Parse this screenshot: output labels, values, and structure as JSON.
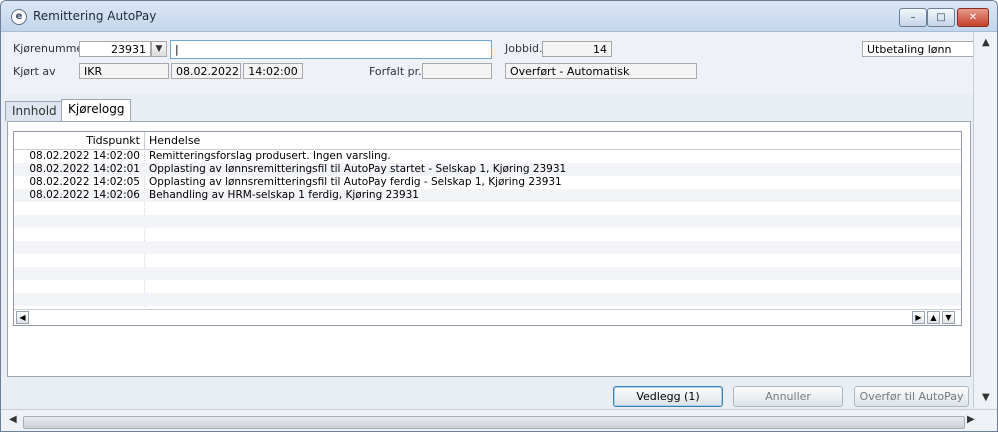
{
  "window": {
    "title": "Remittering AutoPay",
    "app_icon": "e",
    "minimize": "–",
    "restore": "□",
    "close": "✕"
  },
  "form": {
    "run_number_label": "Kjørenummer",
    "run_number_value": "23931",
    "description_value": "|",
    "job_label": "Jobbid.",
    "job_value": "14",
    "type_value": "Utbetaling lønn",
    "run_by_label": "Kjørt av",
    "run_by_value": "IKR",
    "run_date": "08.02.2022",
    "run_time": "14:02:00",
    "due_label": "Forfalt pr.",
    "due_value": "",
    "status_value": "Overført - Automatisk"
  },
  "tabs": [
    {
      "label": "Innhold"
    },
    {
      "label": "Kjørelogg"
    }
  ],
  "log": {
    "columns": [
      "Tidspunkt",
      "Hendelse"
    ],
    "rows": [
      {
        "time": "08.02.2022 14:02:00",
        "event": "Remitteringsforslag produsert. Ingen varsling."
      },
      {
        "time": "08.02.2022 14:02:01",
        "event": "Opplasting av lønnsremitteringsfil til AutoPay startet - Selskap 1, Kjøring 23931"
      },
      {
        "time": "08.02.2022 14:02:05",
        "event": "Opplasting av lønnsremitteringsfil til AutoPay ferdig - Selskap 1, Kjøring 23931"
      },
      {
        "time": "08.02.2022 14:02:06",
        "event": "Behandling av HRM-selskap 1 ferdig, Kjøring 23931"
      }
    ]
  },
  "buttons": {
    "attachments": "Vedlegg (1)",
    "cancel": "Annuller",
    "transfer": "Overfør til AutoPay"
  },
  "icons": {
    "dropdown": "chevron-down-icon",
    "left": "arrow-left-icon",
    "right": "arrow-right-icon",
    "up": "arrow-up-icon",
    "down": "arrow-down-icon"
  },
  "colors": {
    "titlebar": "#c4d6ec",
    "active_border": "#6fa7d6",
    "close": "#c5402a"
  }
}
